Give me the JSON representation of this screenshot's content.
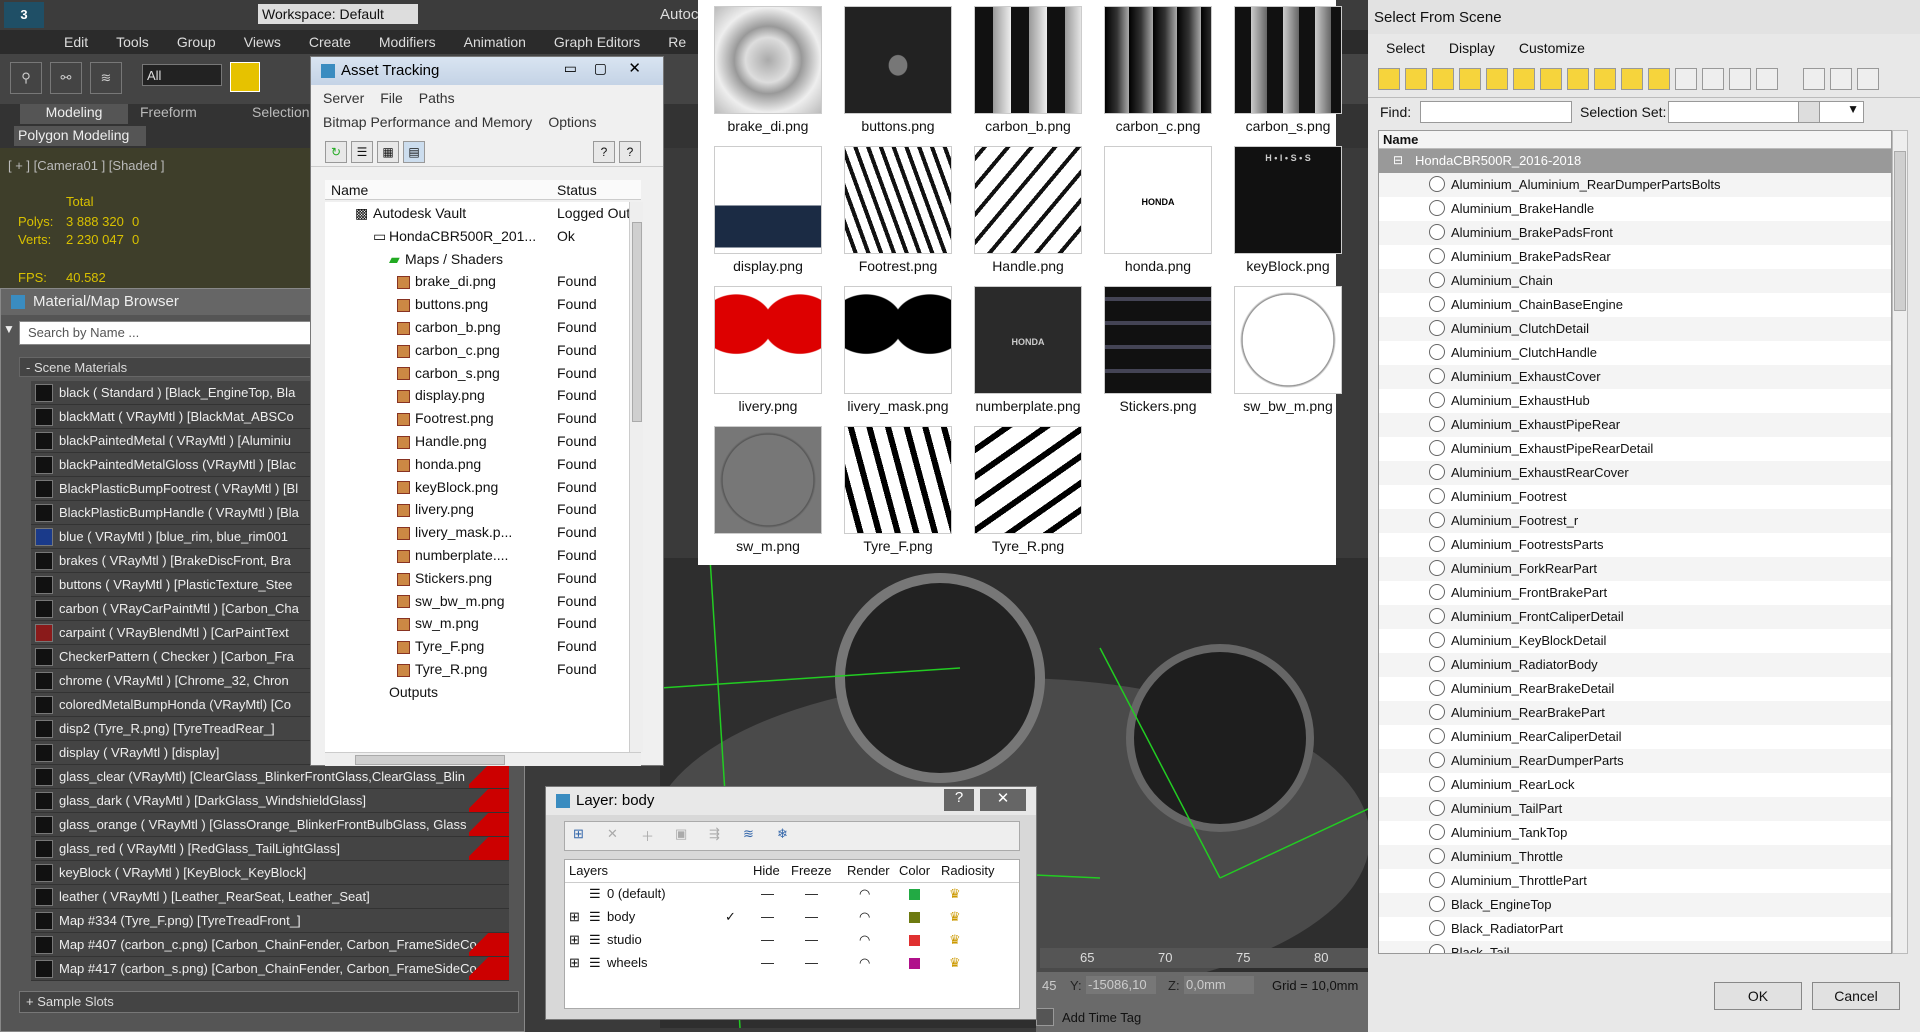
{
  "app": {
    "title_partial": "Autoc",
    "workspace": "Workspace: Default",
    "menus": [
      "Edit",
      "Tools",
      "Group",
      "Views",
      "Create",
      "Modifiers",
      "Animation",
      "Graph Editors",
      "Re"
    ],
    "selection_filter": "All",
    "ribbon_tabs": [
      "Modeling",
      "Freeform",
      "Selection"
    ],
    "ribbon_sub": "Polygon Modeling",
    "viewport_label": "[ + ] [Camera01 ] [Shaded ]",
    "stats": {
      "total_label": "Total",
      "polys_label": "Polys:",
      "polys": "3 888 320",
      "polys_sel": "0",
      "verts_label": "Verts:",
      "verts": "2 230 047",
      "verts_sel": "0",
      "fps_label": "FPS:",
      "fps": "40.582"
    },
    "timeline_ticks": [
      "65",
      "70",
      "75",
      "80"
    ],
    "coords": {
      "x": "45",
      "y_label": "Y:",
      "y": "-15086,10",
      "z_label": "Z:",
      "z": "0,0mm",
      "grid": "Grid = 10,0mm"
    },
    "add_time_tag": "Add Time Tag"
  },
  "material_browser": {
    "title": "Material/Map Browser",
    "search_placeholder": "Search by Name ...",
    "section": "- Scene Materials",
    "items": [
      "black  ( Standard )  [Black_EngineTop, Bla",
      "blackMatt  ( VRayMtl )  [BlackMat_ABSCo",
      "blackPaintedMetal  ( VRayMtl )  [Aluminiu",
      "blackPaintedMetalGloss  (VRayMtl )  [Blac",
      "BlackPlasticBumpFootrest  ( VRayMtl )  [Bl",
      "BlackPlasticBumpHandle  ( VRayMtl )  [Bla",
      "blue  ( VRayMtl )  [blue_rim, blue_rim001",
      "brakes  ( VRayMtl )  [BrakeDiscFront, Bra",
      "buttons  ( VRayMtl )  [PlasticTexture_Stee",
      "carbon  ( VRayCarPaintMtl )  [Carbon_Cha",
      "carpaint  ( VRayBlendMtl )  [CarPaintText",
      "CheckerPattern  ( Checker )  [Carbon_Fra",
      "chrome  ( VRayMtl )  [Chrome_32, Chron",
      "coloredMetalBumpHonda  (VRayMtl)  [Co",
      "disp2  (Tyre_R.png)  [TyreTreadRear_]",
      "display  ( VRayMtl )  [display]",
      "glass_clear  (VRayMtl)  [ClearGlass_BlinkerFrontGlass,ClearGlass_Blin",
      "glass_dark  ( VRayMtl )  [DarkGlass_WindshieldGlass]",
      "glass_orange  ( VRayMtl )  [GlassOrange_BlinkerFrontBulbGlass, Glass",
      "glass_red  ( VRayMtl )  [RedGlass_TailLightGlass]",
      "keyBlock  ( VRayMtl )  [KeyBlock_KeyBlock]",
      "leather  ( VRayMtl )  [Leather_RearSeat, Leather_Seat]",
      "Map #334 (Tyre_F.png)  [TyreTreadFront_]",
      "Map #407 (carbon_c.png)  [Carbon_ChainFender, Carbon_FrameSideCo",
      "Map #417 (carbon_s.png)  [Carbon_ChainFender, Carbon_FrameSideCo"
    ],
    "sample_slots": "+ Sample Slots"
  },
  "asset_tracking": {
    "title": "Asset Tracking",
    "menu1": [
      "Server",
      "File",
      "Paths"
    ],
    "menu2": [
      "Bitmap Performance and Memory",
      "Options"
    ],
    "col_name": "Name",
    "col_status": "Status",
    "vault": {
      "name": "Autodesk Vault",
      "status": "Logged Out ."
    },
    "file": {
      "name": "HondaCBR500R_201...",
      "status": "Ok"
    },
    "folder": "Maps / Shaders",
    "maps": [
      {
        "name": "brake_di.png",
        "status": "Found"
      },
      {
        "name": "buttons.png",
        "status": "Found"
      },
      {
        "name": "carbon_b.png",
        "status": "Found"
      },
      {
        "name": "carbon_c.png",
        "status": "Found"
      },
      {
        "name": "carbon_s.png",
        "status": "Found"
      },
      {
        "name": "display.png",
        "status": "Found"
      },
      {
        "name": "Footrest.png",
        "status": "Found"
      },
      {
        "name": "Handle.png",
        "status": "Found"
      },
      {
        "name": "honda.png",
        "status": "Found"
      },
      {
        "name": "keyBlock.png",
        "status": "Found"
      },
      {
        "name": "livery.png",
        "status": "Found"
      },
      {
        "name": "livery_mask.p...",
        "status": "Found"
      },
      {
        "name": "numberplate....",
        "status": "Found"
      },
      {
        "name": "Stickers.png",
        "status": "Found"
      },
      {
        "name": "sw_bw_m.png",
        "status": "Found"
      },
      {
        "name": "sw_m.png",
        "status": "Found"
      },
      {
        "name": "Tyre_F.png",
        "status": "Found"
      },
      {
        "name": "Tyre_R.png",
        "status": "Found"
      }
    ],
    "outputs": "Outputs"
  },
  "thumbnails": [
    "brake_di.png",
    "buttons.png",
    "carbon_b.png",
    "carbon_c.png",
    "carbon_s.png",
    "display.png",
    "Footrest.png",
    "Handle.png",
    "honda.png",
    "keyBlock.png",
    "livery.png",
    "livery_mask.png",
    "numberplate.png",
    "Stickers.png",
    "sw_bw_m.png",
    "sw_m.png",
    "Tyre_F.png",
    "Tyre_R.png"
  ],
  "thumb_text": {
    "honda": "HONDA",
    "numberplate": "HONDA",
    "keyblock": "H • I • S • S"
  },
  "select_from_scene": {
    "title": "Select From Scene",
    "menus": [
      "Select",
      "Display",
      "Customize"
    ],
    "find_label": "Find:",
    "selection_set_label": "Selection Set:",
    "col_name": "Name",
    "root": "HondaCBR500R_2016-2018",
    "items": [
      "Aluminium_Aluminium_RearDumperPartsBolts",
      "Aluminium_BrakeHandle",
      "Aluminium_BrakePadsFront",
      "Aluminium_BrakePadsRear",
      "Aluminium_Chain",
      "Aluminium_ChainBaseEngine",
      "Aluminium_ClutchDetail",
      "Aluminium_ClutchHandle",
      "Aluminium_ExhaustCover",
      "Aluminium_ExhaustHub",
      "Aluminium_ExhaustPipeRear",
      "Aluminium_ExhaustPipeRearDetail",
      "Aluminium_ExhaustRearCover",
      "Aluminium_Footrest",
      "Aluminium_Footrest_r",
      "Aluminium_FootrestsParts",
      "Aluminium_ForkRearPart",
      "Aluminium_FrontBrakePart",
      "Aluminium_FrontCaliperDetail",
      "Aluminium_KeyBlockDetail",
      "Aluminium_RadiatorBody",
      "Aluminium_RearBrakeDetail",
      "Aluminium_RearBrakePart",
      "Aluminium_RearCaliperDetail",
      "Aluminium_RearDumperParts",
      "Aluminium_RearLock",
      "Aluminium_TailPart",
      "Aluminium_TankTop",
      "Aluminium_Throttle",
      "Aluminium_ThrottlePart",
      "Black_EngineTop",
      "Black_RadiatorPart",
      "Black_Tail"
    ],
    "ok": "OK",
    "cancel": "Cancel"
  },
  "layer_window": {
    "title": "Layer: body",
    "help": "?",
    "close": "✕",
    "columns": [
      "Layers",
      "Hide",
      "Freeze",
      "Render",
      "Color",
      "Radiosity"
    ],
    "layers": [
      {
        "name": "0 (default)",
        "color": "#22aa44",
        "checked": ""
      },
      {
        "name": "body",
        "color": "#6d7a10",
        "checked": "✓"
      },
      {
        "name": "studio",
        "color": "#e03030",
        "checked": ""
      },
      {
        "name": "wheels",
        "color": "#b0108a",
        "checked": ""
      }
    ]
  }
}
